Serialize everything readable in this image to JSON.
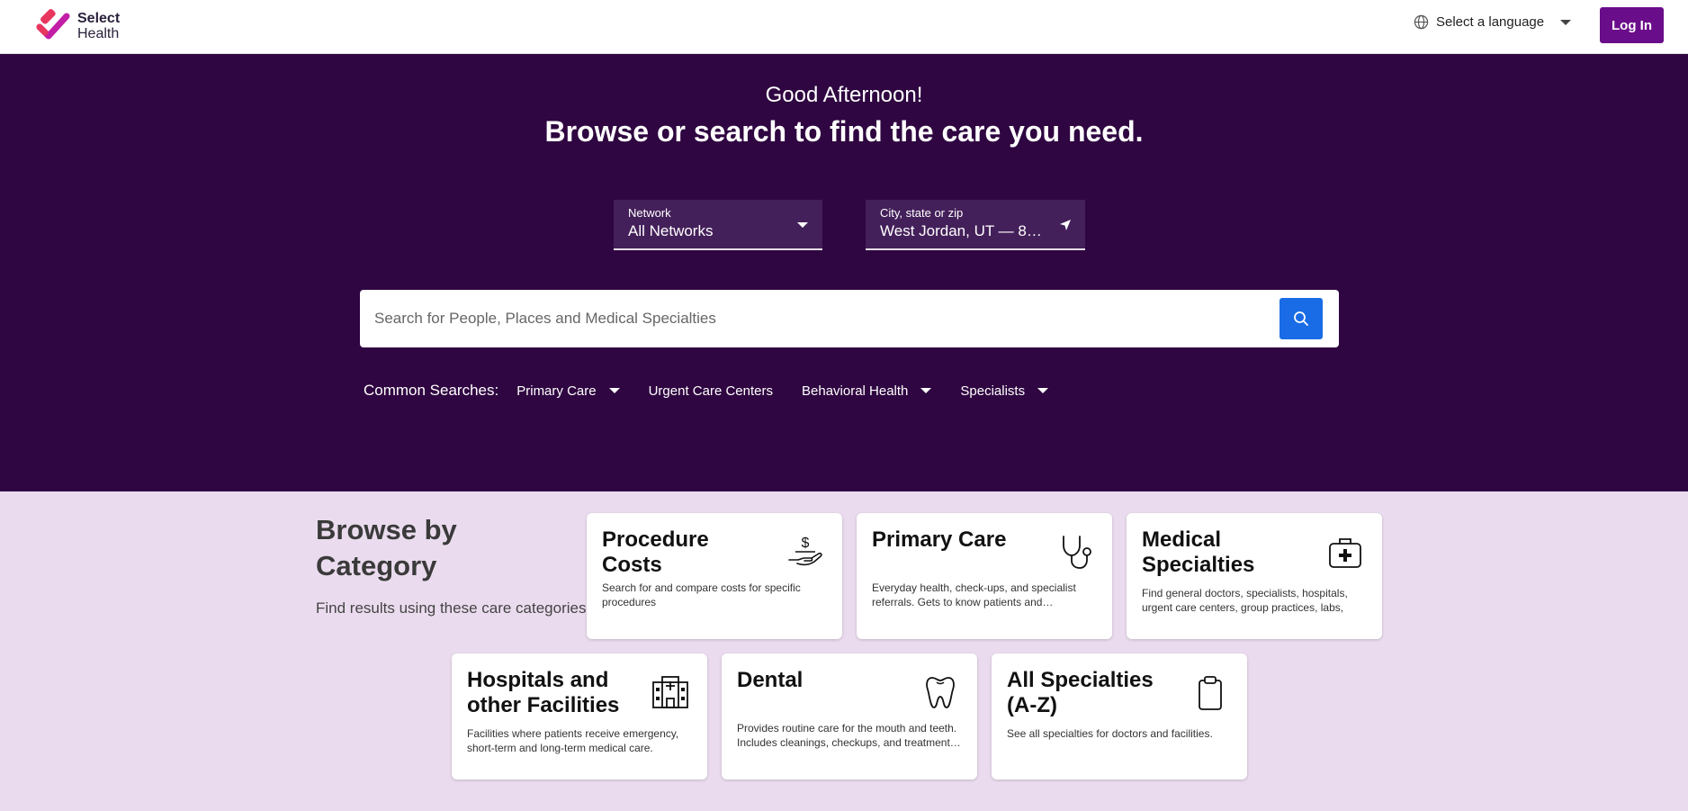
{
  "header": {
    "logo_line1": "Select",
    "logo_line2": "Health",
    "language_label": "Select a language",
    "login_label": "Log In"
  },
  "hero": {
    "greeting": "Good Afternoon!",
    "headline": "Browse or search to find the care you need.",
    "network": {
      "label": "Network",
      "value": "All Networks"
    },
    "location": {
      "label": "City, state or zip",
      "value": "West Jordan, UT — 84…"
    },
    "search": {
      "placeholder": "Search for People, Places and Medical Specialties"
    },
    "common_searches_label": "Common Searches:",
    "common_searches": [
      {
        "label": "Primary Care",
        "has_dropdown": true
      },
      {
        "label": "Urgent Care Centers",
        "has_dropdown": false
      },
      {
        "label": "Behavioral Health",
        "has_dropdown": true
      },
      {
        "label": "Specialists",
        "has_dropdown": true
      }
    ]
  },
  "browse": {
    "title": "Browse by Category",
    "subtitle": "Find results using these care categories",
    "cards": [
      {
        "title": "Procedure Costs",
        "description": "Search for and compare costs for specific procedures",
        "icon": "hand-dollar-icon"
      },
      {
        "title": "Primary Care",
        "description": "Everyday health, check-ups, and specialist referrals. Gets to know patients and…",
        "icon": "stethoscope-icon"
      },
      {
        "title": "Medical Specialties",
        "description": "Find general doctors, specialists, hospitals, urgent care centers, group practices, labs, an…",
        "icon": "medical-kit-icon"
      },
      {
        "title": "Hospitals and other Facilities",
        "description": "Facilities where patients receive emergency, short-term and long-term medical care.",
        "icon": "hospital-icon"
      },
      {
        "title": "Dental",
        "description": "Provides routine care for the mouth and teeth. Includes cleanings, checkups, and treatment…",
        "icon": "tooth-icon"
      },
      {
        "title": "All Specialties (A-Z)",
        "description": "See all specialties for doctors and facilities.",
        "icon": "clipboard-icon"
      }
    ]
  },
  "colors": {
    "hero_bg": "#2f0641",
    "page_bg": "#eadcee",
    "accent_purple": "#6a0d8a",
    "search_button": "#1a6ce6"
  }
}
